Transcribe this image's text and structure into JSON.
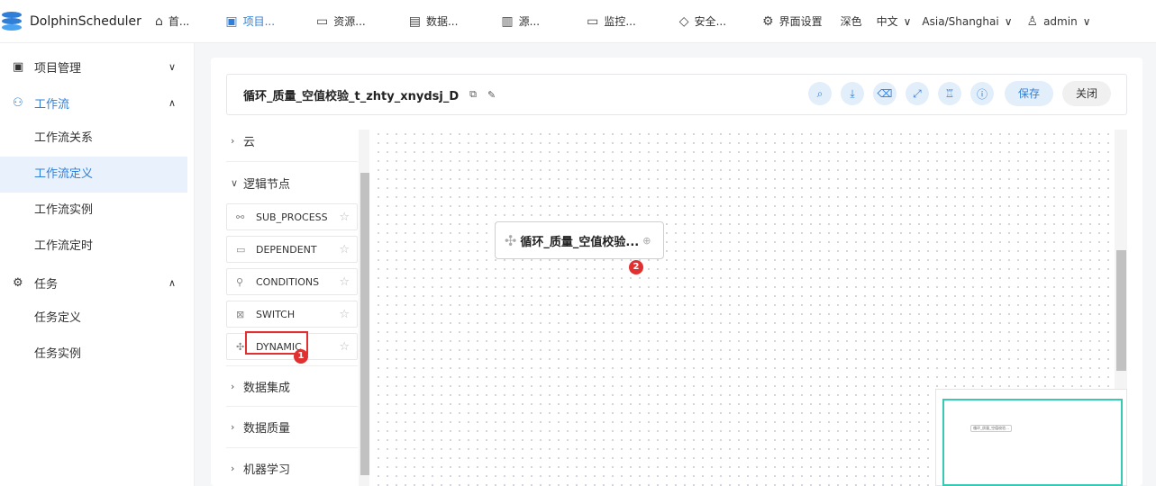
{
  "app": {
    "logo_text": "DolphinScheduler"
  },
  "topnav": {
    "items": [
      {
        "label": "首...",
        "icon": "home-icon"
      },
      {
        "label": "项目...",
        "icon": "project-icon"
      },
      {
        "label": "资源...",
        "icon": "folder-icon"
      },
      {
        "label": "数据...",
        "icon": "datasource-icon"
      },
      {
        "label": "源...",
        "icon": "source-icon"
      },
      {
        "label": "监控...",
        "icon": "monitor-icon"
      },
      {
        "label": "安全...",
        "icon": "shield-icon"
      }
    ],
    "ui_settings": "界面设置",
    "theme": "深色",
    "language": "中文",
    "timezone": "Asia/Shanghai",
    "user": "admin"
  },
  "sidebar": {
    "project_mgmt": "项目管理",
    "workflow": "工作流",
    "workflow_items": [
      "工作流关系",
      "工作流定义",
      "工作流实例",
      "工作流定时"
    ],
    "task": "任务",
    "task_items": [
      "任务定义",
      "任务实例"
    ]
  },
  "editor": {
    "title": "循环_质量_空值校验_t_zhty_xnydsj_D",
    "save": "保存",
    "close": "关闭",
    "toolbar_icons": [
      "search-icon",
      "download-icon",
      "delete-icon",
      "fullscreen-icon",
      "format-icon",
      "info-icon"
    ]
  },
  "panel": {
    "categories": {
      "cloud": "云",
      "logic": "逻辑节点",
      "data_integration": "数据集成",
      "data_quality": "数据质量",
      "ml": "机器学习"
    },
    "logic_nodes": [
      "SUB_PROCESS",
      "DEPENDENT",
      "CONDITIONS",
      "SWITCH",
      "DYNAMIC"
    ]
  },
  "canvas": {
    "node_label": "循环_质量_空值校验...",
    "minimap_node_label": "循环_质量_空值校验..."
  },
  "annotations": {
    "badge1": "1",
    "badge2": "2"
  }
}
